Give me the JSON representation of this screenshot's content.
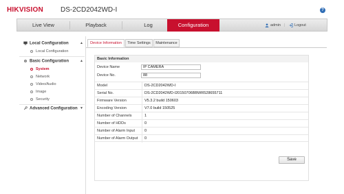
{
  "header": {
    "logo_text": "HIKVISION",
    "device_model": "DS-2CD2042WD-I",
    "help_icon": "?"
  },
  "nav": {
    "tabs": [
      {
        "label": "Live View"
      },
      {
        "label": "Playback"
      },
      {
        "label": "Log"
      },
      {
        "label": "Configuration",
        "active": true
      }
    ],
    "user": "admin",
    "logout": "Logout",
    "accent_color": "#c8102e"
  },
  "sidebar": {
    "groups": [
      {
        "label": "Local Configuration",
        "items": [
          {
            "label": "Local Configuration"
          }
        ]
      },
      {
        "label": "Basic Configuration",
        "items": [
          {
            "label": "System",
            "active": true
          },
          {
            "label": "Network"
          },
          {
            "label": "Video/Audio"
          },
          {
            "label": "Image"
          },
          {
            "label": "Security"
          }
        ]
      },
      {
        "label": "Advanced Configuration",
        "items": []
      }
    ]
  },
  "subtabs": [
    {
      "label": "Device Information",
      "active": true
    },
    {
      "label": "Time Settings"
    },
    {
      "label": "Maintenance"
    }
  ],
  "basic_info": {
    "section_title": "Basic Information",
    "device_name_label": "Device Name",
    "device_name_value": "IP CAMERA",
    "device_no_label": "Device No.",
    "device_no_value": "88",
    "rows": [
      {
        "key": "Model",
        "value": "DS-2CD2042WD-I"
      },
      {
        "key": "Serial No.",
        "value": "DS-2CD2042WD-I20150706BBWR528655711"
      },
      {
        "key": "Firmware Version",
        "value": "V5.3.2 build 150603"
      },
      {
        "key": "Encoding Version",
        "value": "V7.0 build 150525"
      },
      {
        "key": "Number of Channels",
        "value": "1"
      },
      {
        "key": "Number of HDDs",
        "value": "0"
      },
      {
        "key": "Number of Alarm Input",
        "value": "0"
      },
      {
        "key": "Number of Alarm Output",
        "value": "0"
      }
    ]
  },
  "actions": {
    "save_label": "Save"
  }
}
